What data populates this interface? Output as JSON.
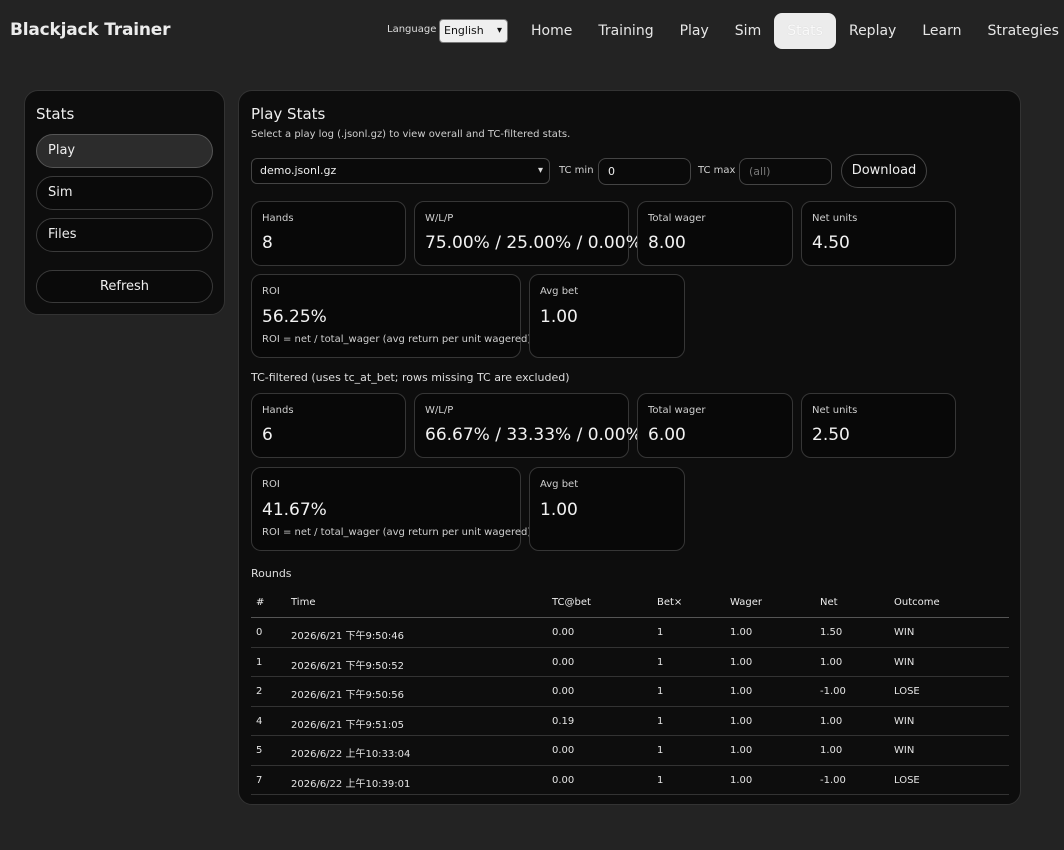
{
  "header": {
    "brand": "Blackjack Trainer",
    "language_label": "Language",
    "language_value": "English",
    "nav": [
      {
        "label": "Home",
        "active": false
      },
      {
        "label": "Training",
        "active": false
      },
      {
        "label": "Play",
        "active": false
      },
      {
        "label": "Sim",
        "active": false
      },
      {
        "label": "Stats",
        "active": true
      },
      {
        "label": "Replay",
        "active": false
      },
      {
        "label": "Learn",
        "active": false
      },
      {
        "label": "Strategies",
        "active": false
      }
    ]
  },
  "sidebar": {
    "title": "Stats",
    "items": [
      {
        "label": "Play",
        "active": true
      },
      {
        "label": "Sim",
        "active": false
      },
      {
        "label": "Files",
        "active": false
      }
    ],
    "refresh_label": "Refresh"
  },
  "main": {
    "title": "Play Stats",
    "subtitle": "Select a play log (.jsonl.gz) to view overall and TC-filtered stats.",
    "file_value": "demo.jsonl.gz",
    "tc_min_label": "TC min",
    "tc_min_value": "0",
    "tc_max_label": "TC max",
    "tc_max_placeholder": "(all)",
    "download_label": "Download",
    "overall": {
      "hands_label": "Hands",
      "hands": "8",
      "wlp_label": "W/L/P",
      "wlp": "75.00% / 25.00% / 0.00%",
      "wager_label": "Total wager",
      "wager": "8.00",
      "net_label": "Net units",
      "net": "4.50",
      "roi_label": "ROI",
      "roi": "56.25%",
      "roi_note": "ROI = net / total_wager (avg return per unit wagered)",
      "avgbet_label": "Avg bet",
      "avgbet": "1.00"
    },
    "filtered_title": "TC-filtered (uses tc_at_bet; rows missing TC are excluded)",
    "filtered": {
      "hands_label": "Hands",
      "hands": "6",
      "wlp_label": "W/L/P",
      "wlp": "66.67% / 33.33% / 0.00%",
      "wager_label": "Total wager",
      "wager": "6.00",
      "net_label": "Net units",
      "net": "2.50",
      "roi_label": "ROI",
      "roi": "41.67%",
      "roi_note": "ROI = net / total_wager (avg return per unit wagered)",
      "avgbet_label": "Avg bet",
      "avgbet": "1.00"
    },
    "rounds_title": "Rounds",
    "columns": [
      "#",
      "Time",
      "TC@bet",
      "Bet×",
      "Wager",
      "Net",
      "Outcome"
    ],
    "rows": [
      [
        "0",
        "2026/6/21 下午9:50:46",
        "0.00",
        "1",
        "1.00",
        "1.50",
        "WIN"
      ],
      [
        "1",
        "2026/6/21 下午9:50:52",
        "0.00",
        "1",
        "1.00",
        "1.00",
        "WIN"
      ],
      [
        "2",
        "2026/6/21 下午9:50:56",
        "0.00",
        "1",
        "1.00",
        "-1.00",
        "LOSE"
      ],
      [
        "4",
        "2026/6/21 下午9:51:05",
        "0.19",
        "1",
        "1.00",
        "1.00",
        "WIN"
      ],
      [
        "5",
        "2026/6/22 上午10:33:04",
        "0.00",
        "1",
        "1.00",
        "1.00",
        "WIN"
      ],
      [
        "7",
        "2026/6/22 上午10:39:01",
        "0.00",
        "1",
        "1.00",
        "-1.00",
        "LOSE"
      ]
    ]
  }
}
